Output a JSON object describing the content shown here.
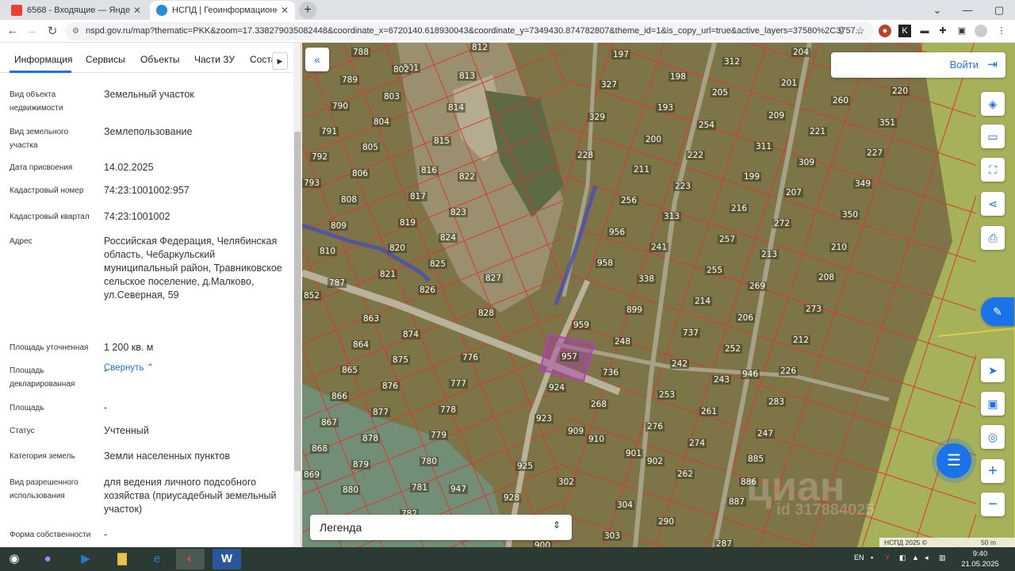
{
  "browser": {
    "tabs": [
      {
        "title": "6568 - Входящие — Яндекс Почта",
        "active": false
      },
      {
        "title": "НСПД | Геоинформационный портал",
        "active": true
      }
    ],
    "new_tab_label": "+",
    "url": "nspd.gov.ru/map?thematic=PKK&zoom=17.338279035082448&coordinate_x=6720140.618930043&coordinate_y=7349430.874782807&theme_id=1&is_copy_url=true&active_layers=37580%2C3757..."
  },
  "panel": {
    "tabs": [
      "Информация",
      "Сервисы",
      "Объекты",
      "Части ЗУ",
      "Соста"
    ],
    "rows": [
      {
        "label": "Вид объекта недвижимости",
        "value": "Земельный участок"
      },
      {
        "label": "Вид земельного участка",
        "value": "Землепользование"
      },
      {
        "label": "Дата присвоения",
        "value": "14.02.2025"
      },
      {
        "label": "Кадастровый номер",
        "value": "74:23:1001002:957"
      },
      {
        "label": "Кадастровый квартал",
        "value": "74:23:1001002"
      },
      {
        "label": "Адрес",
        "value": "Российская Федерация, Челябинская область, Чебаркульский муниципальный район, Травниковское сельское поселение, д.Малково, ул.Северная, 59"
      },
      {
        "label": "Площадь уточненная",
        "value": "1 200 кв. м"
      },
      {
        "label": "Площадь декларированная",
        "value": "-"
      },
      {
        "label": "Площадь",
        "value": "-"
      },
      {
        "label": "Статус",
        "value": "Учтенный"
      },
      {
        "label": "Категория земель",
        "value": "Земли населенных пунктов"
      },
      {
        "label": "Вид разрешенного использования",
        "value": "для ведения личного подсобного хозяйства (приусадебный земельный участок)"
      },
      {
        "label": "Форма собственности",
        "value": "-"
      }
    ],
    "collapse_label": "Свернуть"
  },
  "map": {
    "login_label": "Войти",
    "legend_label": "Легенда",
    "copyright": "НСПД 2025 ©",
    "scale": "50 m",
    "watermark": "циан",
    "watermark_id": "id 317884025",
    "selected_parcel": "957",
    "parcel_numbers": [
      "788",
      "801",
      "812",
      "789",
      "802",
      "813",
      "790",
      "803",
      "814",
      "791",
      "804",
      "815",
      "792",
      "805",
      "793",
      "806",
      "816",
      "822",
      "808",
      "817",
      "823",
      "809",
      "819",
      "824",
      "810",
      "820",
      "825",
      "821",
      "826",
      "787",
      "852",
      "827",
      "863",
      "828",
      "874",
      "864",
      "875",
      "776",
      "865",
      "876",
      "777",
      "866",
      "877",
      "778",
      "867",
      "878",
      "779",
      "868",
      "879",
      "780",
      "869",
      "880",
      "781",
      "947",
      "782",
      "928",
      "197",
      "198",
      "312",
      "204",
      "327",
      "205",
      "201",
      "260",
      "220",
      "193",
      "329",
      "209",
      "351",
      "200",
      "254",
      "221",
      "228",
      "222",
      "311",
      "227",
      "211",
      "309",
      "223",
      "199",
      "349",
      "256",
      "207",
      "313",
      "216",
      "272",
      "350",
      "956",
      "241",
      "257",
      "210",
      "958",
      "213",
      "255",
      "208",
      "338",
      "269",
      "214",
      "899",
      "737",
      "273",
      "959",
      "206",
      "248",
      "212",
      "252",
      "957",
      "242",
      "946",
      "226",
      "736",
      "243",
      "924",
      "253",
      "283",
      "268",
      "261",
      "923",
      "909",
      "276",
      "910",
      "247",
      "274",
      "901",
      "902",
      "885",
      "925",
      "262",
      "886",
      "302",
      "887",
      "304",
      "290",
      "303",
      "287",
      "900"
    ]
  },
  "taskbar": {
    "lang": "EN",
    "time": "9:40",
    "date": "21.05.2025"
  }
}
